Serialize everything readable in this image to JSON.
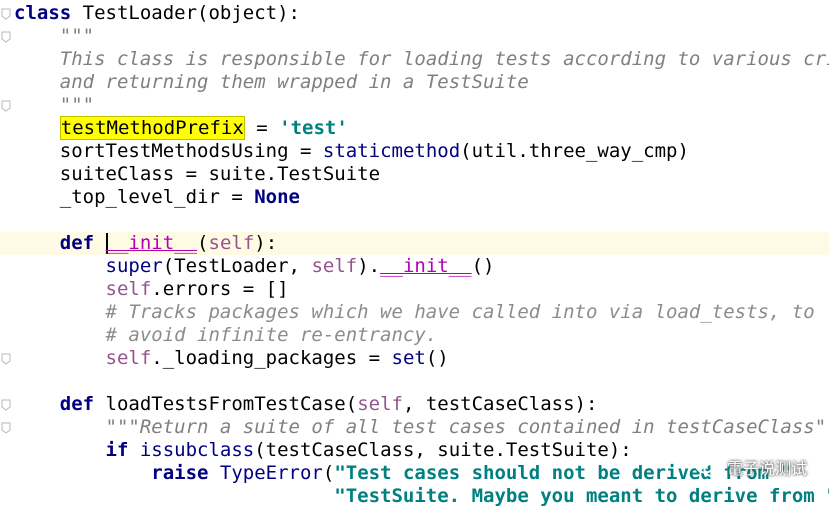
{
  "editor": {
    "lines": [
      {
        "id": "l1",
        "indent": 0,
        "tokens": [
          {
            "t": "class ",
            "c": "kw"
          },
          {
            "t": "TestLoader(object):",
            "c": "cls"
          }
        ]
      },
      {
        "id": "l2",
        "indent": 4,
        "tokens": [
          {
            "t": "\"\"\"",
            "c": "doc"
          }
        ]
      },
      {
        "id": "l3",
        "indent": 4,
        "tokens": [
          {
            "t": "This class is responsible for loading tests according to various crite",
            "c": "doc"
          }
        ]
      },
      {
        "id": "l4",
        "indent": 4,
        "tokens": [
          {
            "t": "and returning them wrapped in a TestSuite",
            "c": "doc"
          }
        ]
      },
      {
        "id": "l5",
        "indent": 4,
        "tokens": [
          {
            "t": "\"\"\"",
            "c": "doc"
          }
        ]
      },
      {
        "id": "l6",
        "indent": 4,
        "tokens": [
          {
            "t": "testMethodPrefix",
            "c": "hl"
          },
          {
            "t": " = ",
            "c": "cls"
          },
          {
            "t": "'test'",
            "c": "strq"
          }
        ]
      },
      {
        "id": "l7",
        "indent": 4,
        "tokens": [
          {
            "t": "sortTestMethodsUsing = ",
            "c": "cls"
          },
          {
            "t": "staticmethod",
            "c": "kwn"
          },
          {
            "t": "(util.three_way_cmp)",
            "c": "cls"
          }
        ]
      },
      {
        "id": "l8",
        "indent": 4,
        "tokens": [
          {
            "t": "suiteClass = suite.TestSuite",
            "c": "cls"
          }
        ]
      },
      {
        "id": "l9",
        "indent": 4,
        "tokens": [
          {
            "t": "_top_level_dir = ",
            "c": "cls"
          },
          {
            "t": "None",
            "c": "kw"
          }
        ]
      },
      {
        "id": "l10",
        "indent": 0,
        "tokens": []
      },
      {
        "id": "l11",
        "indent": 4,
        "current": true,
        "tokens": [
          {
            "t": "def ",
            "c": "kw"
          },
          {
            "t": "CARET",
            "c": "caret"
          },
          {
            "t": "__init__",
            "c": "dunder-u"
          },
          {
            "t": "(",
            "c": "cls"
          },
          {
            "t": "self",
            "c": "self"
          },
          {
            "t": "):",
            "c": "cls"
          }
        ]
      },
      {
        "id": "l12",
        "indent": 8,
        "tokens": [
          {
            "t": "super",
            "c": "kwn"
          },
          {
            "t": "(TestLoader, ",
            "c": "cls"
          },
          {
            "t": "self",
            "c": "self"
          },
          {
            "t": ").",
            "c": "cls"
          },
          {
            "t": "__init__",
            "c": "dunder-u"
          },
          {
            "t": "()",
            "c": "cls"
          }
        ]
      },
      {
        "id": "l13",
        "indent": 8,
        "tokens": [
          {
            "t": "self",
            "c": "self"
          },
          {
            "t": ".errors = []",
            "c": "cls"
          }
        ]
      },
      {
        "id": "l14",
        "indent": 8,
        "tokens": [
          {
            "t": "# Tracks packages which we have called into via load_tests, to",
            "c": "cmt"
          }
        ]
      },
      {
        "id": "l15",
        "indent": 8,
        "tokens": [
          {
            "t": "# avoid infinite re-entrancy.",
            "c": "cmt"
          }
        ]
      },
      {
        "id": "l16",
        "indent": 8,
        "tokens": [
          {
            "t": "self",
            "c": "self"
          },
          {
            "t": "._loading_packages = ",
            "c": "cls"
          },
          {
            "t": "set",
            "c": "kwn"
          },
          {
            "t": "()",
            "c": "cls"
          }
        ]
      },
      {
        "id": "l17",
        "indent": 0,
        "tokens": []
      },
      {
        "id": "l18",
        "indent": 4,
        "tokens": [
          {
            "t": "def ",
            "c": "kw"
          },
          {
            "t": "loadTestsFromTestCase(",
            "c": "cls"
          },
          {
            "t": "self",
            "c": "self"
          },
          {
            "t": ", testCaseClass):",
            "c": "cls"
          }
        ]
      },
      {
        "id": "l19",
        "indent": 8,
        "tokens": [
          {
            "t": "\"\"\"Return a suite of all test cases contained in testCaseClass\"\"\"",
            "c": "doc"
          }
        ]
      },
      {
        "id": "l20",
        "indent": 8,
        "tokens": [
          {
            "t": "if ",
            "c": "kw"
          },
          {
            "t": "issubclass",
            "c": "kwn"
          },
          {
            "t": "(testCaseClass, suite.TestSuite):",
            "c": "cls"
          }
        ]
      },
      {
        "id": "l21",
        "indent": 12,
        "tokens": [
          {
            "t": "raise ",
            "c": "kw"
          },
          {
            "t": "TypeError",
            "c": "kwn"
          },
          {
            "t": "(",
            "c": "cls"
          },
          {
            "t": "\"Test cases should not be derived from \"",
            "c": "strq"
          }
        ]
      },
      {
        "id": "l22",
        "indent": 28,
        "tokens": [
          {
            "t": "\"TestSuite. Maybe you meant to derive from \"",
            "c": "strq"
          }
        ]
      }
    ]
  },
  "watermark": {
    "text": "電子说测试",
    "icon": "wechat-icon"
  },
  "colors": {
    "keyword": "#000080",
    "self": "#94558d",
    "dunder": "#b200b2",
    "string": "#008080",
    "comment": "#8c8c8c",
    "highlight": "#ffff00"
  }
}
